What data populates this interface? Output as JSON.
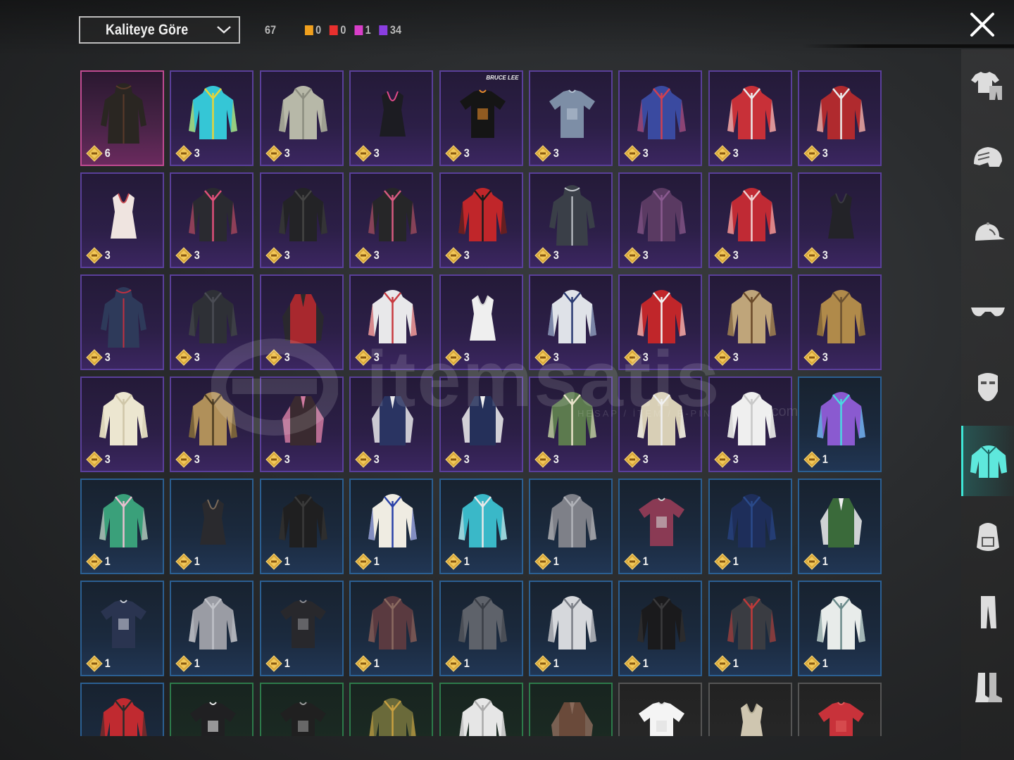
{
  "toolbar": {
    "sort_label": "Kaliteye Göre",
    "total_count": "67",
    "quality_counts": [
      {
        "color": "#f0a01e",
        "value": "0"
      },
      {
        "color": "#e8302e",
        "value": "0"
      },
      {
        "color": "#d83ec8",
        "value": "1"
      },
      {
        "color": "#8a3ee0",
        "value": "34"
      }
    ]
  },
  "watermark": {
    "text": "itemsatis",
    "sub": "HESAP / İTEM / E-PIN",
    "domain": ".com"
  },
  "grid": {
    "rows": [
      [
        {
          "tier": "pink",
          "qty": "6",
          "item": "long-hooded-coat-dark"
        },
        {
          "tier": "purple",
          "qty": "3",
          "item": "hoodie-cyan"
        },
        {
          "tier": "purple",
          "qty": "3",
          "item": "hoodie-grey"
        },
        {
          "tier": "purple",
          "qty": "3",
          "item": "crop-top-black"
        },
        {
          "tier": "purple",
          "qty": "3",
          "item": "bruce-lee-tshirt",
          "badge": "BRUCE LEE"
        },
        {
          "tier": "purple",
          "qty": "3",
          "item": "tshirt-blue-grey"
        },
        {
          "tier": "purple",
          "qty": "3",
          "item": "jacket-blue-red-hood"
        },
        {
          "tier": "purple",
          "qty": "3",
          "item": "jacket-red"
        },
        {
          "tier": "purple",
          "qty": "3",
          "item": "jacket-red-white"
        }
      ],
      [
        {
          "tier": "purple",
          "qty": "3",
          "item": "floral-crop-top"
        },
        {
          "tier": "purple",
          "qty": "3",
          "item": "jacket-black-pink"
        },
        {
          "tier": "purple",
          "qty": "3",
          "item": "jacket-black"
        },
        {
          "tier": "purple",
          "qty": "3",
          "item": "jacket-black-stripe"
        },
        {
          "tier": "purple",
          "qty": "3",
          "item": "hoodie-red-black"
        },
        {
          "tier": "purple",
          "qty": "3",
          "item": "long-coat-grey"
        },
        {
          "tier": "purple",
          "qty": "3",
          "item": "hooded-jacket-purple"
        },
        {
          "tier": "purple",
          "qty": "3",
          "item": "tied-shirt-red"
        },
        {
          "tier": "purple",
          "qty": "3",
          "item": "sports-bra-black"
        }
      ],
      [
        {
          "tier": "purple",
          "qty": "3",
          "item": "dress-navy-red"
        },
        {
          "tier": "purple",
          "qty": "3",
          "item": "shirt-dark-grey"
        },
        {
          "tier": "purple",
          "qty": "3",
          "item": "flannel-vest-red"
        },
        {
          "tier": "purple",
          "qty": "3",
          "item": "jacket-white-red"
        },
        {
          "tier": "purple",
          "qty": "3",
          "item": "tank-top-white"
        },
        {
          "tier": "purple",
          "qty": "3",
          "item": "jacket-white-navy"
        },
        {
          "tier": "purple",
          "qty": "3",
          "item": "jacket-red-white-racing"
        },
        {
          "tier": "purple",
          "qty": "3",
          "item": "shirt-khaki-tie"
        },
        {
          "tier": "purple",
          "qty": "3",
          "item": "jacket-tan"
        }
      ],
      [
        {
          "tier": "purple",
          "qty": "3",
          "item": "blouse-cream-lace"
        },
        {
          "tier": "purple",
          "qty": "3",
          "item": "plaid-jacket-tan"
        },
        {
          "tier": "purple",
          "qty": "3",
          "item": "leather-vest-pink"
        },
        {
          "tier": "purple",
          "qty": "3",
          "item": "varsity-vest-navy"
        },
        {
          "tier": "purple",
          "qty": "3",
          "item": "school-vest-navy"
        },
        {
          "tier": "purple",
          "qty": "3",
          "item": "sweater-green"
        },
        {
          "tier": "purple",
          "qty": "3",
          "item": "blazer-cream"
        },
        {
          "tier": "purple",
          "qty": "3",
          "item": "shirt-white"
        },
        {
          "tier": "blue",
          "qty": "1",
          "item": "track-jacket-purple-cyan"
        }
      ],
      [
        {
          "tier": "blue",
          "qty": "1",
          "item": "hawaiian-shirt-green"
        },
        {
          "tier": "blue",
          "qty": "1",
          "item": "tank-top-black"
        },
        {
          "tier": "blue",
          "qty": "1",
          "item": "leather-jacket-black"
        },
        {
          "tier": "blue",
          "qty": "1",
          "item": "varsity-jacket-white-blue"
        },
        {
          "tier": "blue",
          "qty": "1",
          "item": "hoodie-teal"
        },
        {
          "tier": "blue",
          "qty": "1",
          "item": "jacket-grey-zip"
        },
        {
          "tier": "blue",
          "qty": "1",
          "item": "rock-tshirt-maroon"
        },
        {
          "tier": "blue",
          "qty": "1",
          "item": "plaid-shirt-navy"
        },
        {
          "tier": "blue",
          "qty": "1",
          "item": "vest-green-white"
        }
      ],
      [
        {
          "tier": "blue",
          "qty": "1",
          "item": "raglan-tshirt-navy"
        },
        {
          "tier": "blue",
          "qty": "1",
          "item": "longsleeve-grey"
        },
        {
          "tier": "blue",
          "qty": "1",
          "item": "raglan-black-grey"
        },
        {
          "tier": "blue",
          "qty": "1",
          "item": "parka-maroon"
        },
        {
          "tier": "blue",
          "qty": "1",
          "item": "parka-grey-plaid"
        },
        {
          "tier": "blue",
          "qty": "1",
          "item": "parka-grey-white"
        },
        {
          "tier": "blue",
          "qty": "1",
          "item": "blazer-black"
        },
        {
          "tier": "blue",
          "qty": "1",
          "item": "shirt-dark-grey-2"
        },
        {
          "tier": "blue",
          "qty": "1",
          "item": "plaid-shirt-white"
        }
      ],
      [
        {
          "tier": "blue",
          "qty": "",
          "item": "plaid-shirt-red"
        },
        {
          "tier": "green",
          "qty": "",
          "item": "tshirt-black-print"
        },
        {
          "tier": "green",
          "qty": "",
          "item": "tshirt-black-skull"
        },
        {
          "tier": "green",
          "qty": "",
          "item": "jacket-olive-fur"
        },
        {
          "tier": "green",
          "qty": "",
          "item": "jacket-white-grey"
        },
        {
          "tier": "green",
          "qty": "",
          "item": "vest-brown"
        },
        {
          "tier": "gray",
          "qty": "",
          "item": "tshirt-white"
        },
        {
          "tier": "gray",
          "qty": "",
          "item": "tank-top-beige"
        },
        {
          "tier": "gray",
          "qty": "",
          "item": "tshirt-red"
        }
      ]
    ]
  },
  "sidebar": {
    "items": [
      {
        "name": "outfit-set-icon",
        "active": false
      },
      {
        "name": "helmet-icon",
        "active": false
      },
      {
        "name": "cap-icon",
        "active": false
      },
      {
        "name": "glasses-icon",
        "active": false
      },
      {
        "name": "mask-icon",
        "active": false
      },
      {
        "name": "shirt-icon",
        "active": true
      },
      {
        "name": "backpack-icon",
        "active": false
      },
      {
        "name": "pants-icon",
        "active": false
      },
      {
        "name": "boots-icon",
        "active": false
      }
    ]
  }
}
